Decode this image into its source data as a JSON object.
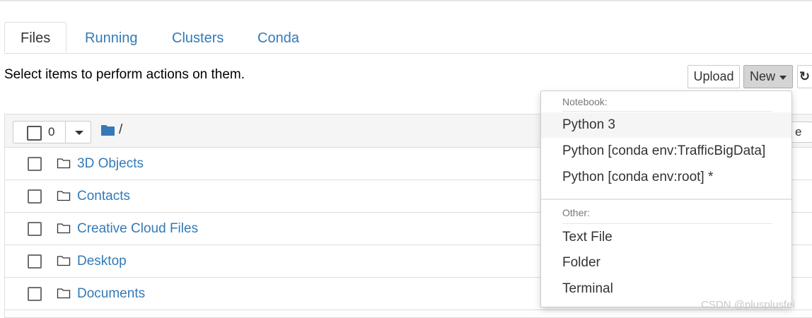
{
  "tabs": [
    {
      "label": "Files",
      "active": true
    },
    {
      "label": "Running",
      "active": false
    },
    {
      "label": "Clusters",
      "active": false
    },
    {
      "label": "Conda",
      "active": false
    }
  ],
  "toolbar": {
    "hint": "Select items to perform actions on them.",
    "upload_label": "Upload",
    "new_label": "New",
    "refresh_icon": "refresh-icon"
  },
  "list_header": {
    "selected_count": "0",
    "breadcrumb": "/",
    "partial_button_text": "e"
  },
  "files": [
    {
      "name": "3D Objects",
      "icon": "folder-icon"
    },
    {
      "name": "Contacts",
      "icon": "folder-icon"
    },
    {
      "name": "Creative Cloud Files",
      "icon": "folder-icon"
    },
    {
      "name": "Desktop",
      "icon": "folder-icon"
    },
    {
      "name": "Documents",
      "icon": "folder-icon"
    }
  ],
  "new_menu": {
    "notebook_header": "Notebook:",
    "notebook_items": [
      "Python 3",
      "Python [conda env:TrafficBigData]",
      "Python [conda env:root] *"
    ],
    "other_header": "Other:",
    "other_items": [
      "Text File",
      "Folder",
      "Terminal"
    ]
  },
  "watermark": "CSDN @plusplusfei",
  "colors": {
    "link": "#337ab7",
    "accent_folder": "#337ab7",
    "new_button_bg": "#d4d4d4"
  }
}
